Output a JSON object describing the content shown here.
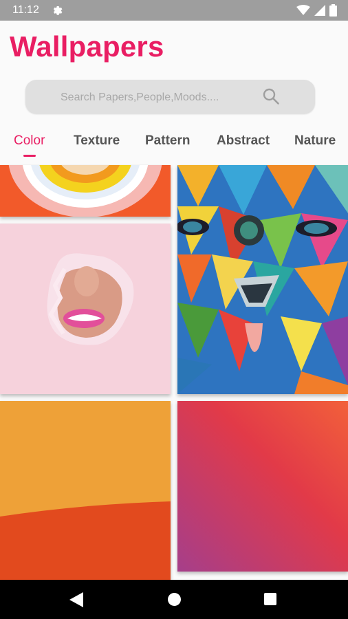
{
  "status_bar": {
    "time": "11:12",
    "icons": [
      "gear-icon",
      "wifi-icon",
      "signal-icon",
      "battery-icon"
    ]
  },
  "app": {
    "title": "Wallpapers",
    "accent_color": "#e91e63"
  },
  "search": {
    "placeholder": "Search Papers,People,Moods....",
    "value": "",
    "icon": "search-icon"
  },
  "tabs": [
    {
      "label": "Color",
      "active": true
    },
    {
      "label": "Texture",
      "active": false
    },
    {
      "label": "Pattern",
      "active": false
    },
    {
      "label": "Abstract",
      "active": false
    },
    {
      "label": "Nature",
      "active": false
    }
  ],
  "gallery": {
    "tiles": [
      "rainbow-stripes-wallpaper",
      "lips-through-torn-paper-wallpaper",
      "colorful-geometric-bear-mural-wallpaper",
      "orange-red-gradient-wallpaper",
      "red-purple-gradient-wallpaper"
    ]
  },
  "nav_bar": {
    "icons": [
      "back-icon",
      "home-icon",
      "recents-icon"
    ]
  }
}
